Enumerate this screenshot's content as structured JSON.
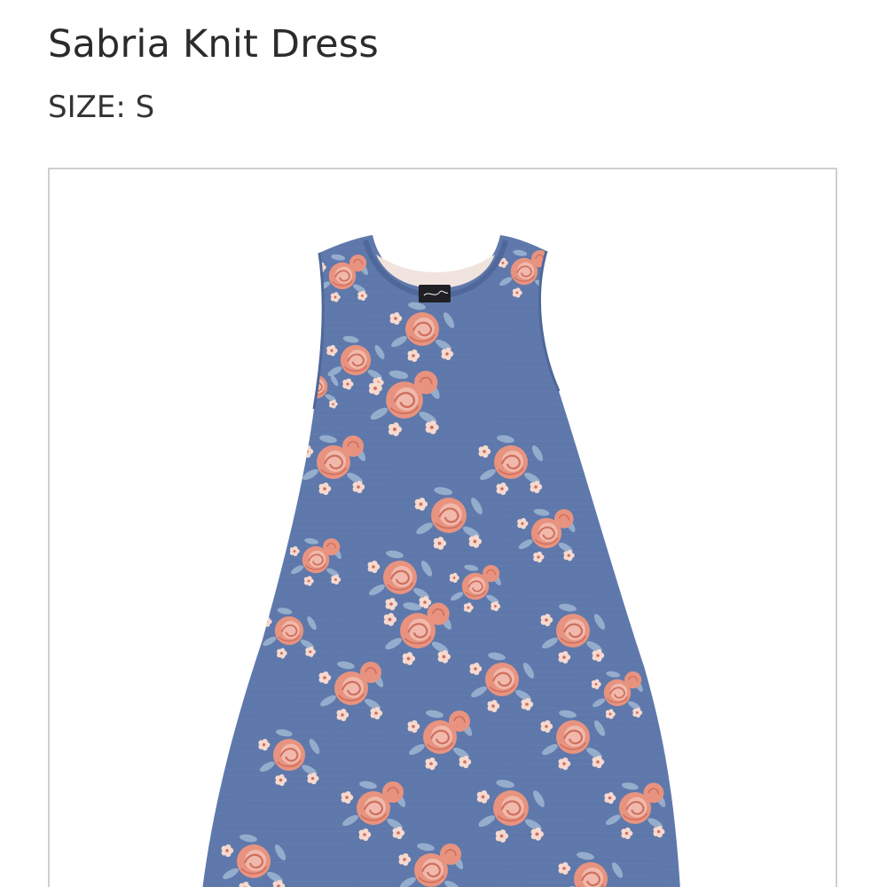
{
  "product": {
    "name": "Sabria Knit Dress",
    "size_label": "SIZE:",
    "size_value": "S"
  },
  "image": {
    "subject": "dress",
    "colors": {
      "fabric": "#5e78ab",
      "fabric_light": "#7189b9",
      "rose": "#e8937f",
      "rose_dark": "#cf6f5f",
      "petal_light": "#f6d9cf",
      "leaf": "#9bb3cf",
      "frame_border": "#cfcfcf"
    }
  }
}
